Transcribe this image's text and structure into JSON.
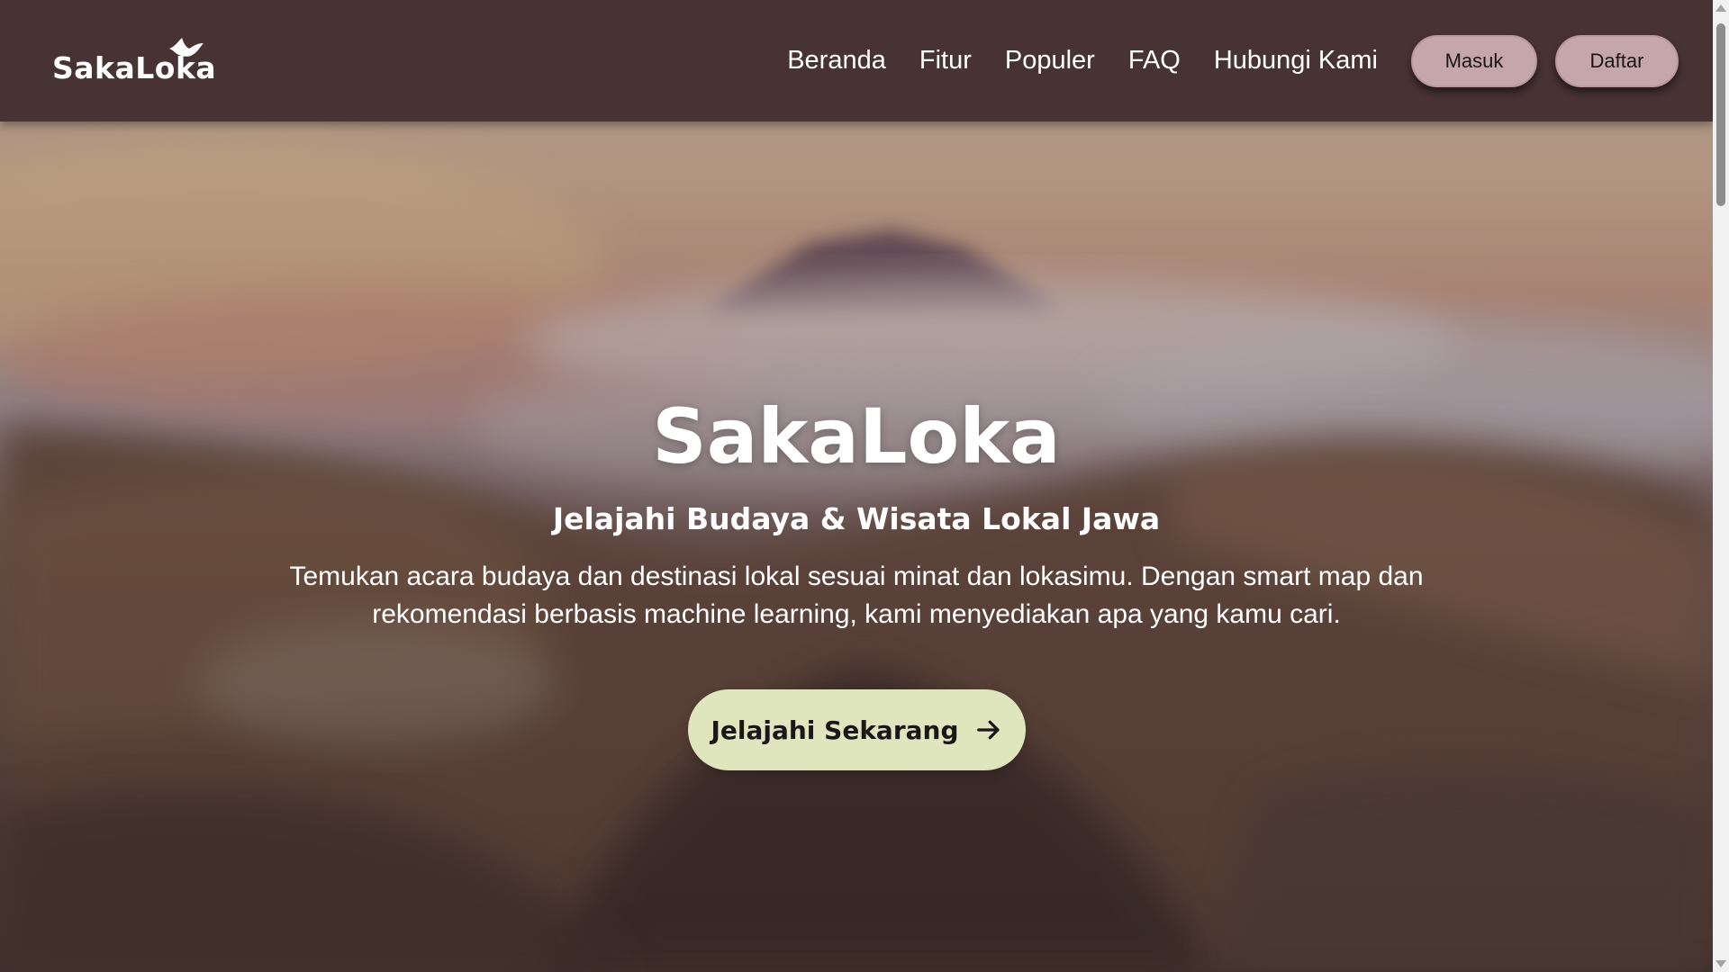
{
  "brand": {
    "logo_text": "SakaLoka",
    "logo_icon": "bird-icon"
  },
  "nav": {
    "links": [
      "Beranda",
      "Fitur",
      "Populer",
      "FAQ",
      "Hubungi Kami"
    ],
    "login_label": "Masuk",
    "register_label": "Daftar"
  },
  "hero": {
    "title": "SakaLoka",
    "subtitle": "Jelajahi Budaya & Wisata Lokal Jawa",
    "description": "Temukan acara budaya dan destinasi lokal sesuai minat dan lokasimu. Dengan smart map dan rekomendasi berbasis machine learning, kami menyediakan apa yang kamu cari.",
    "cta_label": "Jelajahi Sekarang",
    "cta_icon": "arrow-right-icon"
  },
  "colors": {
    "navbar": "#473234",
    "nav_button": "#c4a6ab",
    "cta_button": "#dfe6be",
    "text": "#ffffff"
  }
}
